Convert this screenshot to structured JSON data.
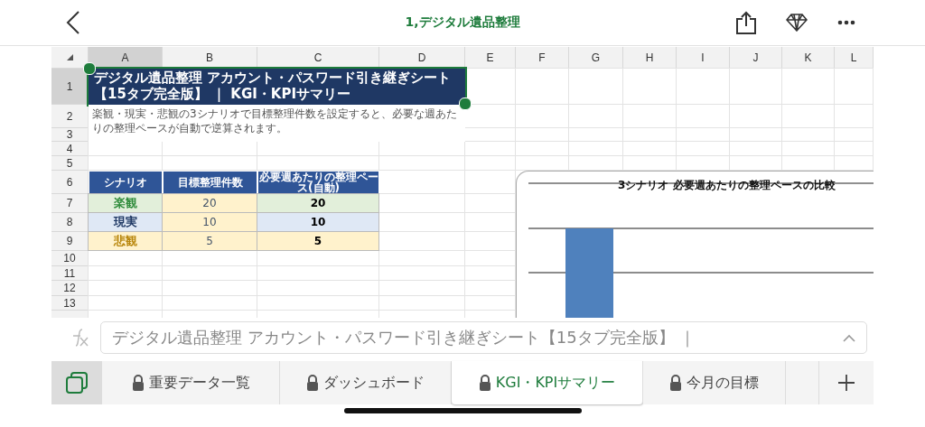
{
  "header": {
    "title": "1,デジタル遺品整理"
  },
  "columns": [
    {
      "label": "A",
      "selected": true
    },
    {
      "label": "B",
      "selected": false
    },
    {
      "label": "C",
      "selected": false
    },
    {
      "label": "D",
      "selected": false
    },
    {
      "label": "E",
      "selected": false
    },
    {
      "label": "F",
      "selected": false
    },
    {
      "label": "G",
      "selected": false
    },
    {
      "label": "H",
      "selected": false
    },
    {
      "label": "I",
      "selected": false
    },
    {
      "label": "J",
      "selected": false
    },
    {
      "label": "K",
      "selected": false
    },
    {
      "label": "L",
      "selected": false
    }
  ],
  "rows": [
    {
      "label": "1",
      "selected": true
    },
    {
      "label": "2",
      "selected": false
    },
    {
      "label": "3",
      "selected": false
    },
    {
      "label": "4",
      "selected": false
    },
    {
      "label": "5",
      "selected": false
    },
    {
      "label": "6",
      "selected": false
    },
    {
      "label": "7",
      "selected": false
    },
    {
      "label": "8",
      "selected": false
    },
    {
      "label": "9",
      "selected": false
    },
    {
      "label": "10",
      "selected": false
    },
    {
      "label": "11",
      "selected": false
    },
    {
      "label": "12",
      "selected": false
    },
    {
      "label": "13",
      "selected": false
    }
  ],
  "title_cell": {
    "text": "デジタル遺品整理 アカウント・パスワード引き継ぎシート【15タブ完全版】 ｜ KGI・KPIサマリー",
    "selected": true
  },
  "description": "楽観・現実・悲観の3シナリオで目標整理件数を設定すると、必要な週あたりの整理ペースが自動で逆算されます。",
  "table": {
    "headers": [
      "シナリオ",
      "目標整理件数",
      "必要週あたりの整理ペース(自動)"
    ],
    "rows": [
      {
        "scenario": "楽観",
        "kind": "optimistic",
        "color": "#2e8b3a",
        "target": "20",
        "pace": "20"
      },
      {
        "scenario": "現実",
        "kind": "realistic",
        "color": "#1f3864",
        "target": "10",
        "pace": "10"
      },
      {
        "scenario": "悲観",
        "kind": "pessimistic",
        "color": "#b8860b",
        "target": "5",
        "pace": "5"
      }
    ]
  },
  "chart": {
    "title": "3シナリオ 必要週あたりの整理ペースの比較",
    "kind": "picture"
  },
  "formula_bar": {
    "value": "デジタル遺品整理 アカウント・パスワード引き継ぎシート【15タブ完全版】 ｜"
  },
  "sheet_tabs": [
    {
      "label": "重要データ一覧",
      "locked": true,
      "selected": false
    },
    {
      "label": "ダッシュボード",
      "locked": true,
      "selected": false
    },
    {
      "label": "KGI・KPIサマリー",
      "locked": true,
      "selected": true
    },
    {
      "label": "今月の目標",
      "locked": true,
      "selected": false
    }
  ]
}
